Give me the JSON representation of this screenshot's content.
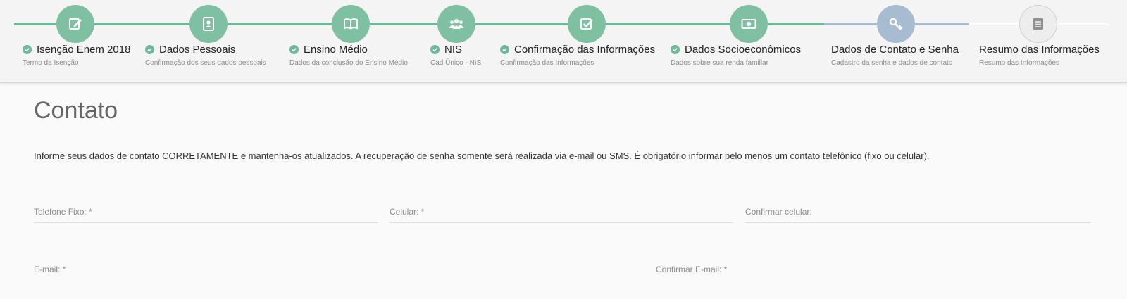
{
  "steps": [
    {
      "title": "Isenção Enem 2018",
      "subtitle": "Termo da Isenção",
      "state": "done",
      "icon": "edit-icon"
    },
    {
      "title": "Dados Pessoais",
      "subtitle": "Confirmação dos seus dados pessoais",
      "state": "done",
      "icon": "id-badge-icon"
    },
    {
      "title": "Ensino Médio",
      "subtitle": "Dados da conclusão do Ensino Médio",
      "state": "done",
      "icon": "book-icon"
    },
    {
      "title": "NIS",
      "subtitle": "Cad Único - NIS",
      "state": "done",
      "icon": "group-icon"
    },
    {
      "title": "Confirmação das Informações",
      "subtitle": "Confirmação das Informações",
      "state": "done",
      "icon": "checkbox-icon"
    },
    {
      "title": "Dados Socioeconômicos",
      "subtitle": "Dados sobre sua renda familiar",
      "state": "done",
      "icon": "money-icon"
    },
    {
      "title": "Dados de Contato e Senha",
      "subtitle": "Cadastro da senha e dados de contato",
      "state": "active",
      "icon": "key-icon"
    },
    {
      "title": "Resumo das Informações",
      "subtitle": "Resumo das Informações",
      "state": "todo",
      "icon": "list-icon"
    }
  ],
  "colors": {
    "done": "#7fc0a3",
    "active": "#a7bcd0",
    "todo": "#ededed"
  },
  "page": {
    "title": "Contato",
    "info": "Informe seus dados de contato CORRETAMENTE e mantenha-os atualizados. A recuperação de senha somente será realizada via e-mail ou SMS. É obrigatório informar pelo menos um contato telefônico (fixo ou celular)."
  },
  "form": {
    "telefone_label": "Telefone Fixo: *",
    "celular_label": "Celular: *",
    "confirmar_celular_label": "Confirmar celular:",
    "email_label": "E-mail: *",
    "confirmar_email_label": "Confirmar E-mail: *"
  }
}
